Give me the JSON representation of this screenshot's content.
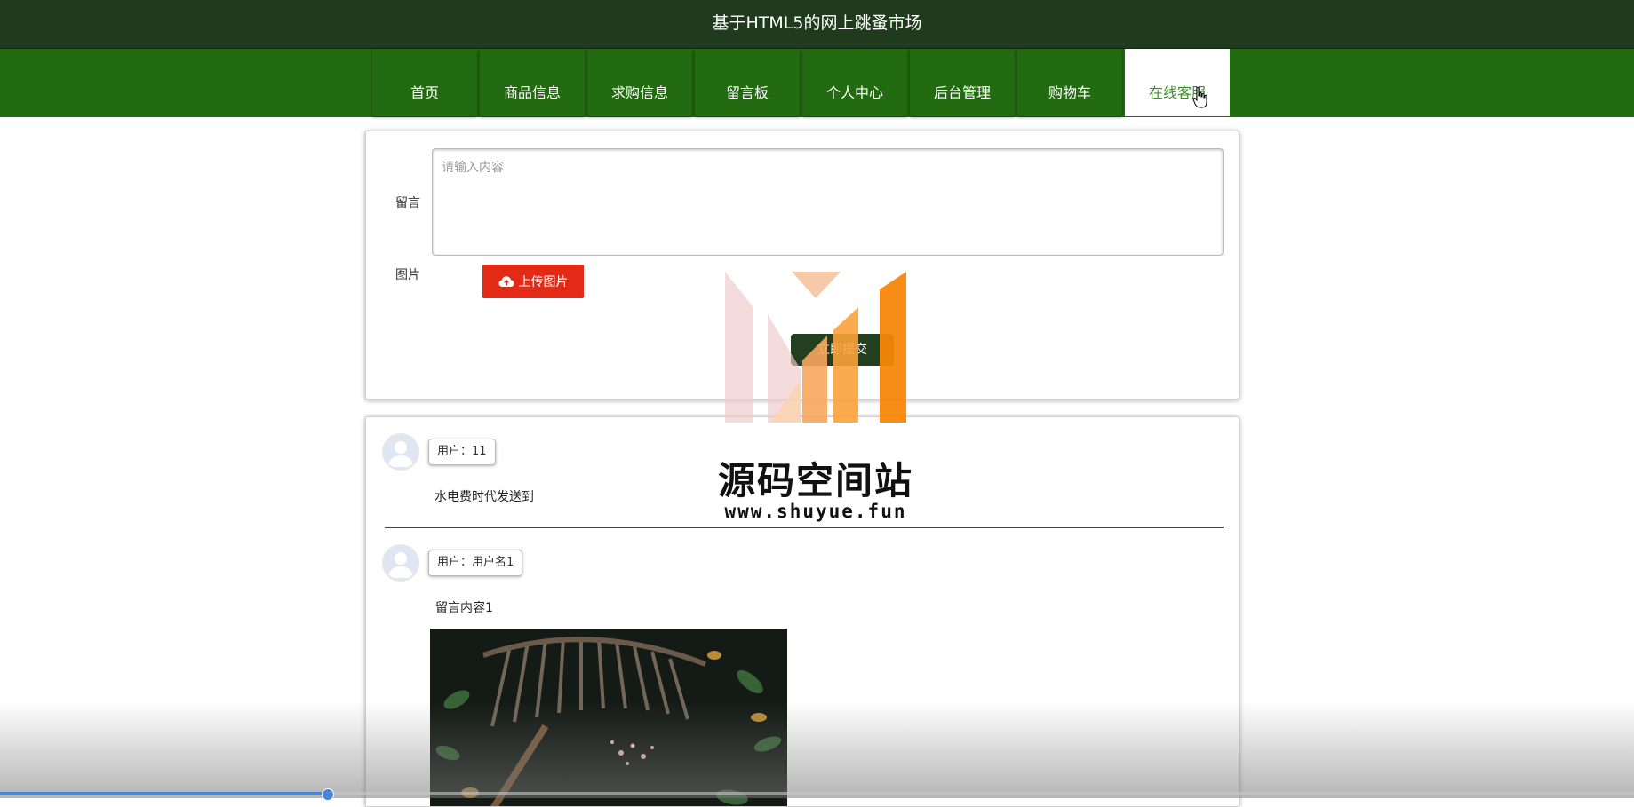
{
  "site": {
    "title": "基于HTML5的网上跳蚤市场"
  },
  "nav": {
    "items": [
      {
        "label": "首页"
      },
      {
        "label": "商品信息"
      },
      {
        "label": "求购信息"
      },
      {
        "label": "留言板"
      },
      {
        "label": "个人中心"
      },
      {
        "label": "后台管理"
      },
      {
        "label": "购物车"
      },
      {
        "label": "在线客服"
      }
    ],
    "active_label": "在线客服"
  },
  "form": {
    "message_label": "留言",
    "message_placeholder": "请输入内容",
    "image_label": "图片",
    "upload_button": "上传图片",
    "upload_icon": "cloud-upload-icon",
    "submit_button": "立即提交"
  },
  "messages": [
    {
      "user": "用户：11",
      "content": "水电费时代发送到"
    },
    {
      "user": "用户：用户名1",
      "content": "留言内容1"
    }
  ],
  "watermark": {
    "name": "源码空间站",
    "url": "www.shuyue.fun"
  },
  "video": {
    "progress": 0.2
  },
  "colors": {
    "header_bg": "#1f3a1d",
    "nav_bg": "#236b10",
    "active_text": "#3e8c2c",
    "upload_btn": "#e22a17",
    "submit_btn": "#223f1f"
  }
}
